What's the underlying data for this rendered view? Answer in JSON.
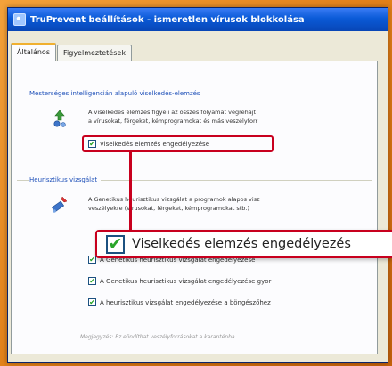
{
  "window": {
    "title": "TruPrevent beállítások - ismeretlen vírusok blokkolása"
  },
  "tabs": [
    {
      "label": "Általános",
      "active": true
    },
    {
      "label": "Figyelmeztetések",
      "active": false
    }
  ],
  "behavior_group": {
    "title": "Mesterséges intelligencián alapuló viselkedés-elemzés",
    "description_line1": "A viselkedés elemzés figyeli az összes folyamat végrehajt",
    "description_line2": "a vírusokat, férgeket, kémprogramokat és más veszélyforr",
    "checkbox_label": "Viselkedés elemzés engedélyezése",
    "checkbox_checked": true
  },
  "heuristic_group": {
    "title": "Heurisztikus vizsgálat",
    "description_line1": "A Genetikus heurisztikus vizsgálat a programok alapos visz",
    "description_line2": "veszélyekre (vírusokat, férgeket, kémprogramokat stb.)",
    "options": [
      {
        "label": "A Genetikus heurisztikus vizsgálat engedélyezése",
        "checked": true
      },
      {
        "label": "A Genetikus heurisztikus vizsgálat engedélyezése gyor",
        "checked": true
      },
      {
        "label": "A heurisztikus vizsgálat engedélyezése a böngészőhez",
        "checked": true
      }
    ],
    "footnote": "Megjegyzés: Ez elindíthat veszélyforrásokat a karanténba"
  },
  "zoom_callout": {
    "label": "Viselkedés elemzés engedélyezés",
    "checked": true
  },
  "colors": {
    "highlight": "#c8001e",
    "titlebar": "#0a5ad7",
    "background": "#e07d16"
  }
}
